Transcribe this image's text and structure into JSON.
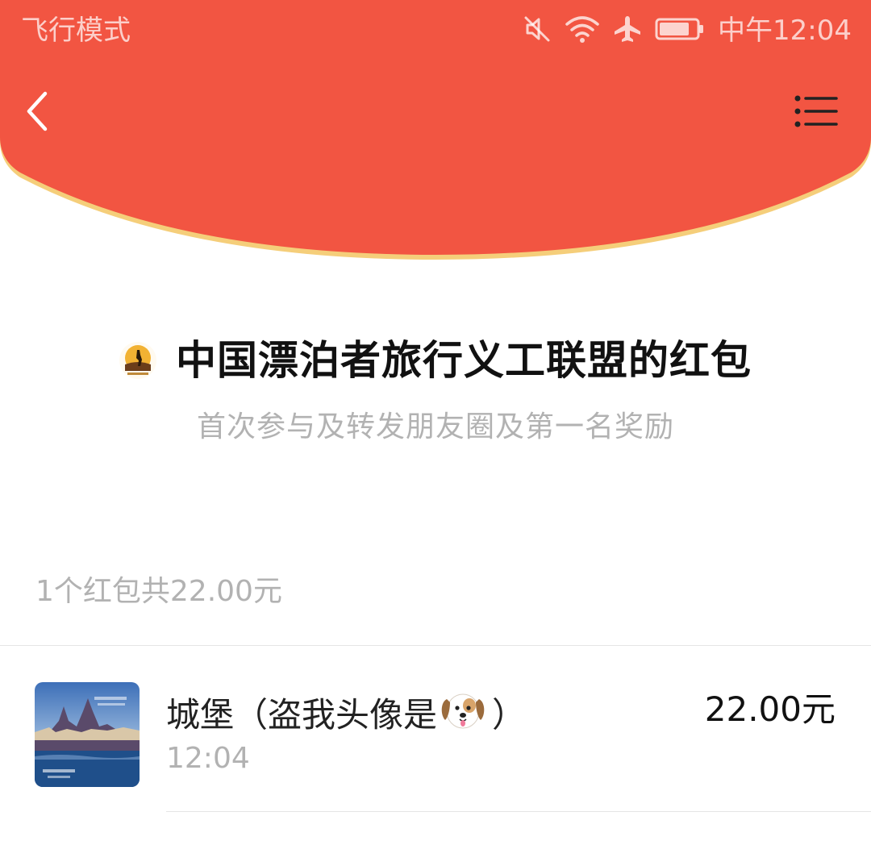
{
  "status_bar": {
    "left_text": "飞行模式",
    "icons": [
      "mute-icon",
      "wifi-icon",
      "airplane-icon",
      "battery-icon"
    ],
    "time": "中午12:04"
  },
  "nav": {
    "back_icon": "chevron-left-icon",
    "menu_icon": "menu-list-icon"
  },
  "packet": {
    "sender_name": "中国漂泊者旅行义工联盟的红包",
    "greeting": "首次参与及转发朋友圈及第一名奖励"
  },
  "summary": "1个红包共22.00元",
  "records": [
    {
      "name_before": "城堡（盗我头像是",
      "name_after": "）",
      "emoji": "dog-face-icon",
      "time": "12:04",
      "amount": "22.00元"
    }
  ],
  "colors": {
    "header_red": "#F25542",
    "header_edge_gold": "#F5CE7A",
    "text_primary": "#111111",
    "text_secondary": "#B2B2B2"
  }
}
